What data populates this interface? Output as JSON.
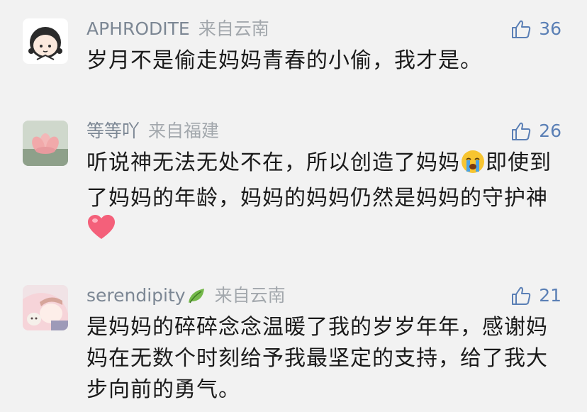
{
  "comments": [
    {
      "username": "APHRODITE",
      "location": "来自云南",
      "likes": "36",
      "text": "岁月不是偷走妈妈青春的小偷，我才是。",
      "avatar_icon": "cartoon-girl-avatar"
    },
    {
      "username": "等等吖",
      "location": "来自福建",
      "likes": "26",
      "text_1": "听说神无法无处不在，所以创造了妈妈",
      "emoji_1": "crying-face-emoji",
      "text_2": "即使到了妈妈的年龄，妈妈的妈妈仍然是妈妈的守护神",
      "emoji_2": "pink-heart-emoji",
      "avatar_icon": "lotus-flower-avatar"
    },
    {
      "username": "serendipity",
      "username_emoji": "leaf-emoji",
      "location": "来自云南",
      "likes": "21",
      "text": "是妈妈的碎碎念念温暖了我的岁岁年年，感谢妈妈在无数个时刻给予我最坚定的支持，给了我大步向前的勇气。",
      "avatar_icon": "anime-illustration-avatar"
    }
  ],
  "colors": {
    "background": "#f2f2f2",
    "username": "#7c8794",
    "location": "#a3a8ad",
    "like": "#5a7fb5",
    "text": "#1a1a1a"
  }
}
